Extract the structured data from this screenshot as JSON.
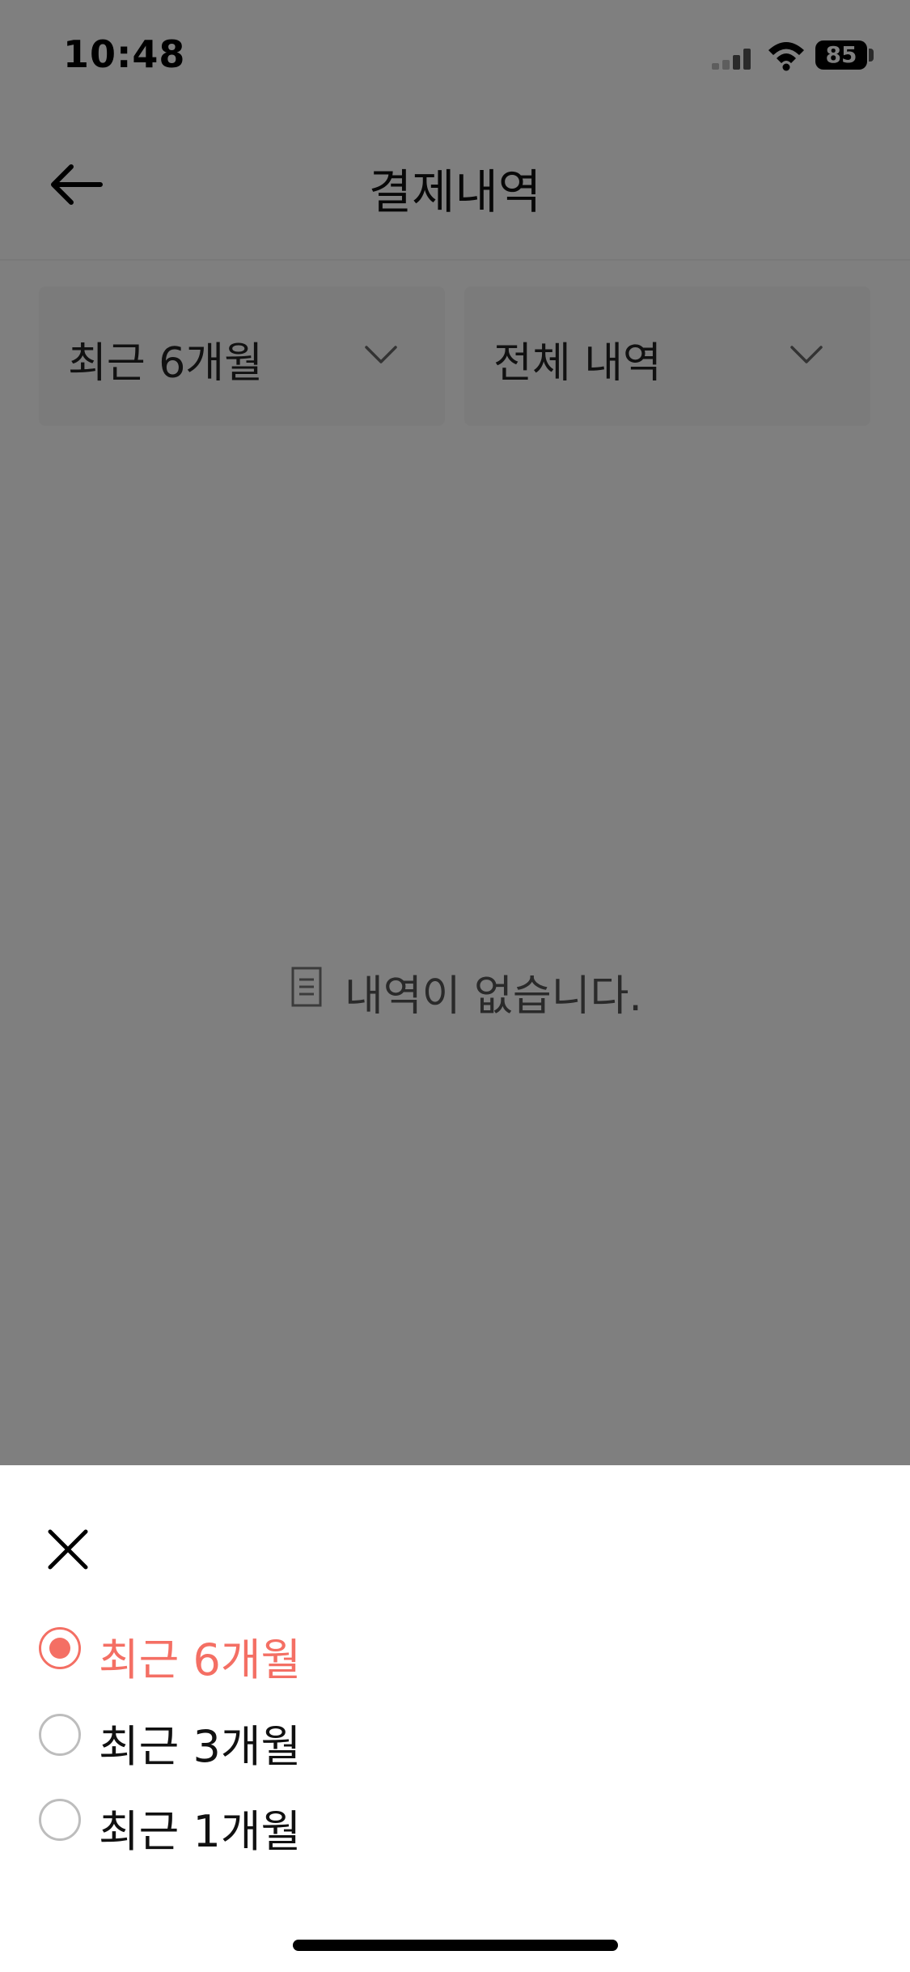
{
  "status_bar": {
    "time": "10:48",
    "battery": "85"
  },
  "header": {
    "title": "결제내역"
  },
  "filters": {
    "period": "최근 6개월",
    "type": "전체 내역"
  },
  "empty_state": {
    "message": "내역이 없습니다."
  },
  "sheet": {
    "options": [
      {
        "label": "최근 6개월",
        "selected": true
      },
      {
        "label": "최근 3개월",
        "selected": false
      },
      {
        "label": "최근 1개월",
        "selected": false
      }
    ]
  },
  "colors": {
    "accent": "#f46f64",
    "overlay": "rgba(0,0,0,0.5)"
  }
}
